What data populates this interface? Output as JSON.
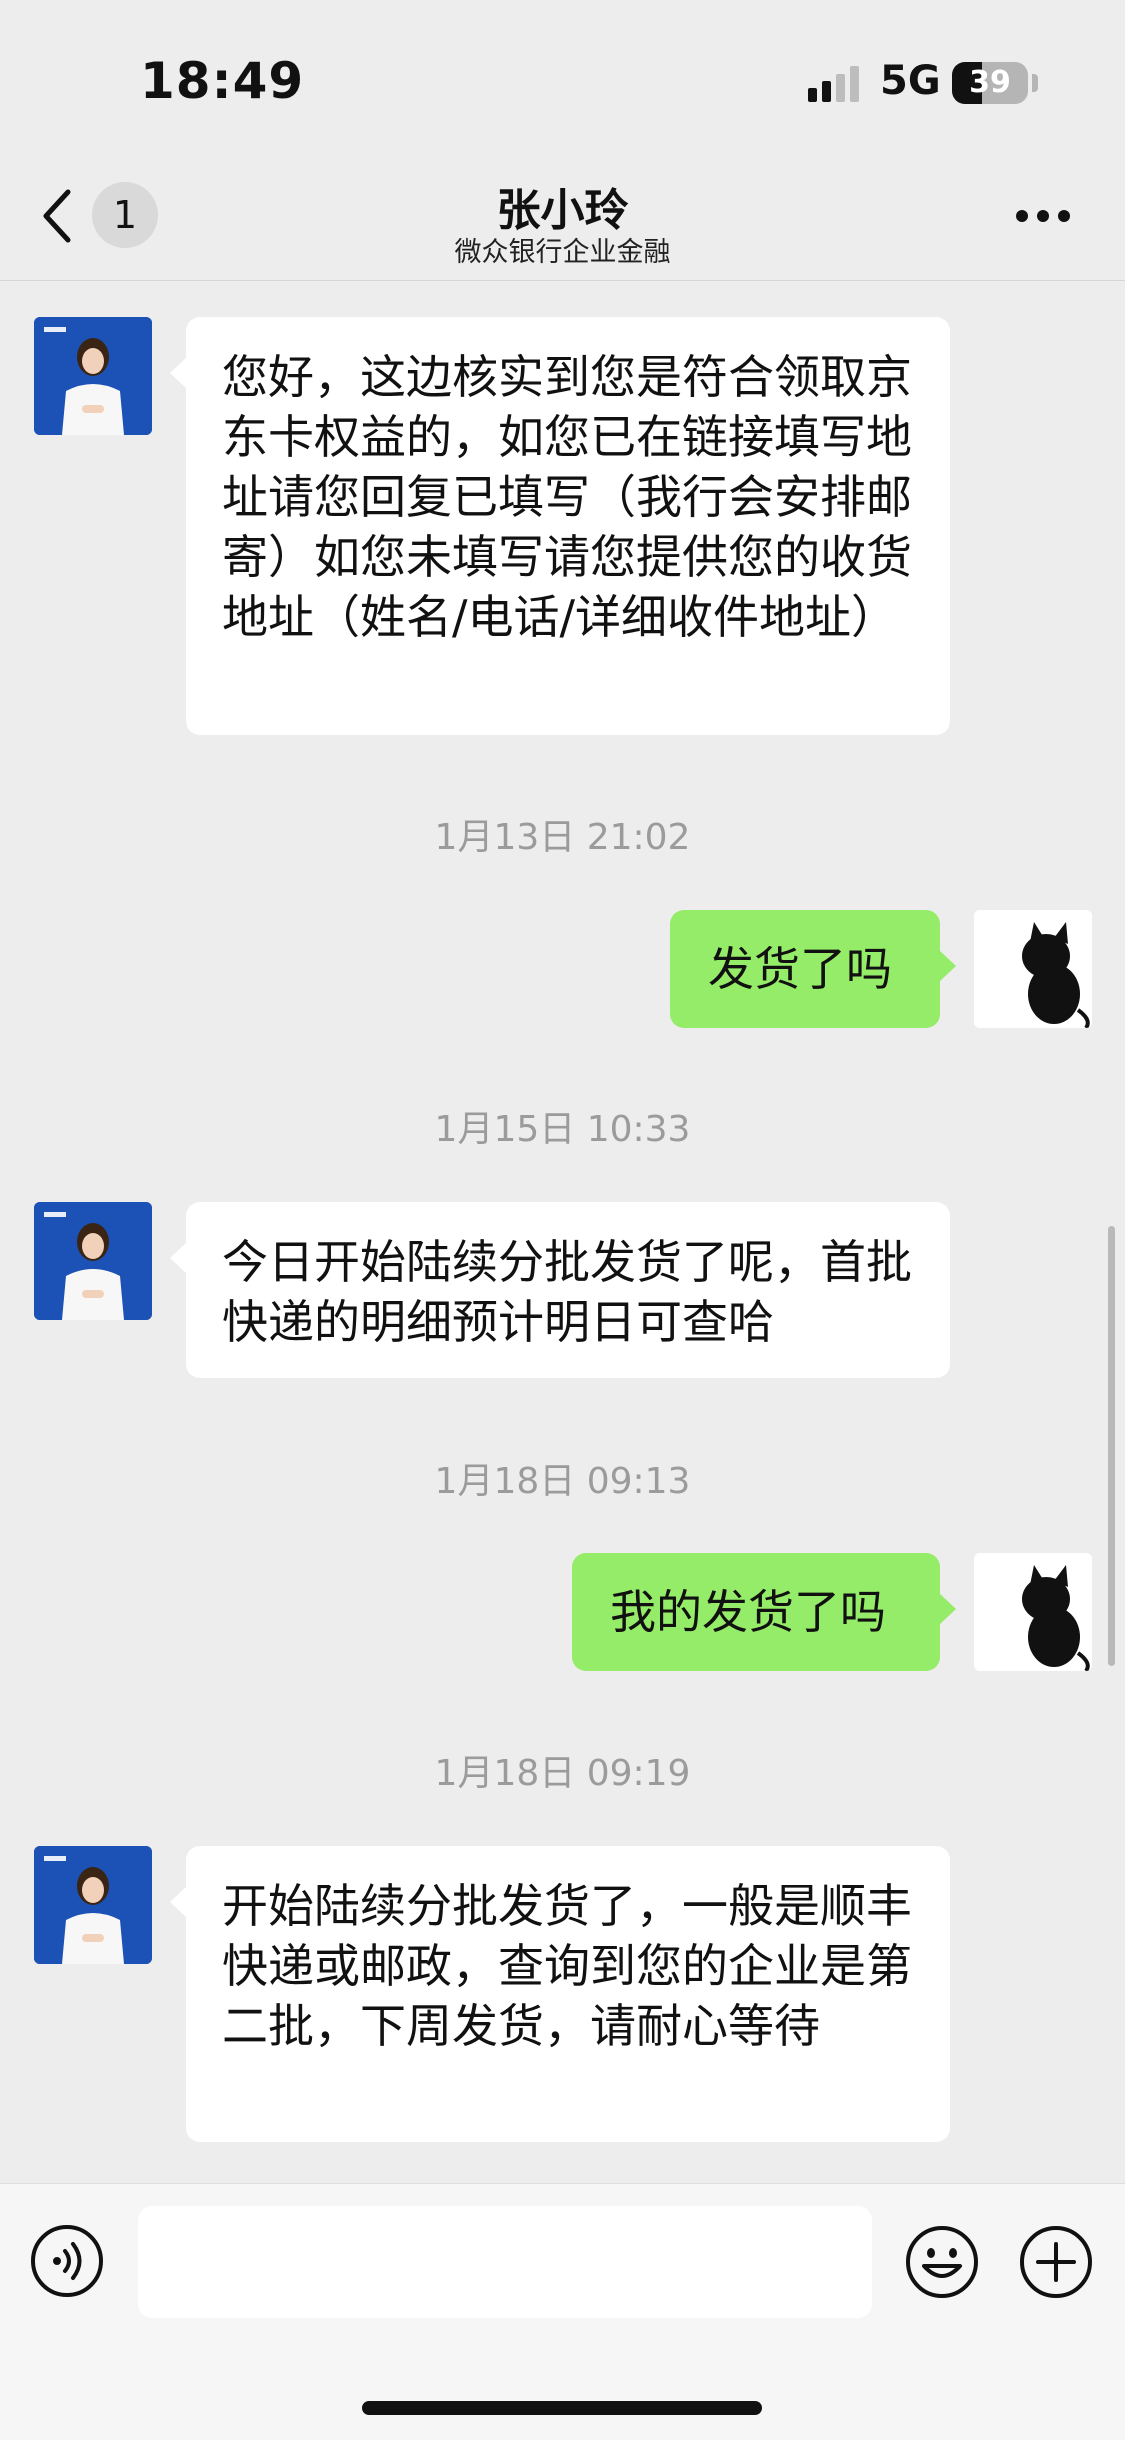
{
  "status_bar": {
    "time": "18:49",
    "network": "5G",
    "battery": "39",
    "battery_level": 0.39
  },
  "nav": {
    "back_icon": "chevron-left-icon",
    "unread_count": "1",
    "title": "张小玲",
    "subtitle": "微众银行企业金融",
    "more_icon": "ellipsis-icon"
  },
  "messages": [
    {
      "type": "in",
      "avatar": "agent-avatar",
      "text": "您好，这边核实到您是符合领取京东卡权益的，如您已在链接填写地址请您回复已填写（我行会安排邮寄）如您未填写请您提供您的收货地址（姓名/电话/详细收件地址）"
    },
    {
      "type": "time",
      "text": "1月13日 21:02"
    },
    {
      "type": "out",
      "avatar": "cat-avatar",
      "text": "发货了吗"
    },
    {
      "type": "time",
      "text": "1月15日 10:33"
    },
    {
      "type": "in",
      "avatar": "agent-avatar",
      "text": "今日开始陆续分批发货了呢，首批快递的明细预计明日可查哈"
    },
    {
      "type": "time",
      "text": "1月18日 09:13"
    },
    {
      "type": "out",
      "avatar": "cat-avatar",
      "text": "我的发货了吗"
    },
    {
      "type": "time",
      "text": "1月18日 09:19"
    },
    {
      "type": "in",
      "avatar": "agent-avatar",
      "text": "开始陆续分批发货了，一般是顺丰快递或邮政，查询到您的企业是第二批，下周发货，请耐心等待"
    }
  ],
  "input_bar": {
    "voice_icon": "voice-icon",
    "input_value": "",
    "emoji_icon": "emoji-icon",
    "plus_icon": "plus-icon"
  },
  "colors": {
    "background": "#ededed",
    "outgoing_bubble": "#95ec69",
    "incoming_bubble": "#ffffff",
    "timestamp_text": "#9b9b9b",
    "avatar_blue": "#1c51b5"
  }
}
